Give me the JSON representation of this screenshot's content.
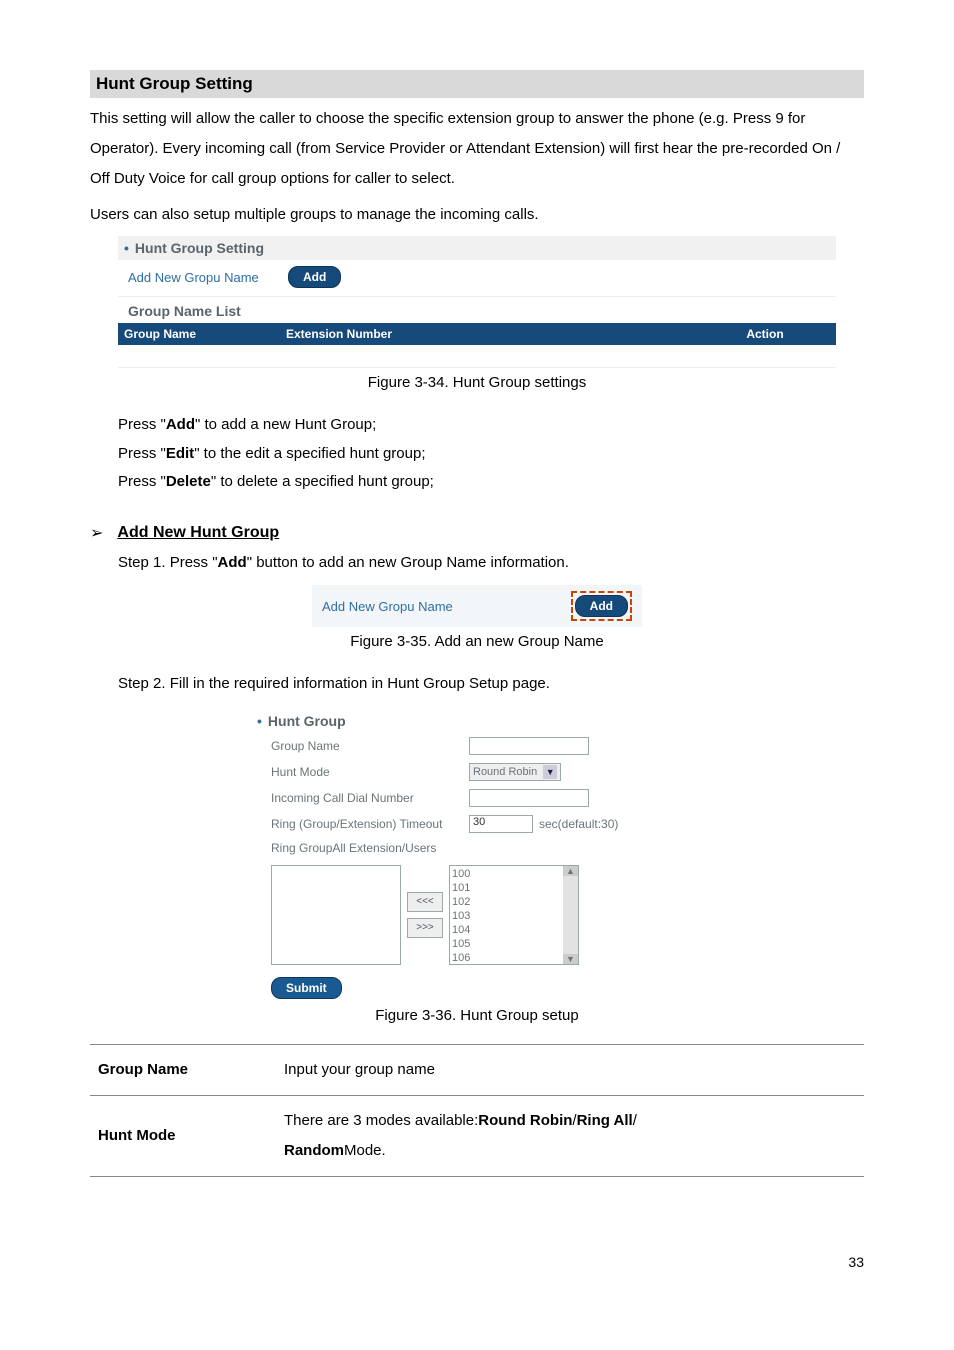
{
  "section": {
    "title": "Hunt Group Setting"
  },
  "intro": {
    "p1": "This setting will allow the caller to choose the specific extension group to answer the phone (e.g. Press 9 for Operator). Every incoming call (from Service Provider or Attendant Extension) will first hear the pre-recorded On / Off Duty Voice for call group options for caller to select.",
    "p2": "Users can also setup multiple groups to manage the incoming calls."
  },
  "fig34": {
    "bullet_title": "Hunt Group Setting",
    "add_label": "Add New Gropu Name",
    "add_btn": "Add",
    "list_title": "Group Name List",
    "th_group": "Group Name",
    "th_ext": "Extension Number",
    "th_action": "Action",
    "caption": "Figure 3-34. Hunt Group settings"
  },
  "press_lines": {
    "l1a": "Press \"",
    "l1b": "Add",
    "l1c": "\" to add a new Hunt Group;",
    "l2a": "Press \"",
    "l2b": "Edit",
    "l2c": "\" to the edit a specified hunt group;",
    "l3a": "Press \"",
    "l3b": "Delete",
    "l3c": "\" to delete a specified hunt group;"
  },
  "sub1": {
    "arrow": "➢",
    "title": "Add New Hunt Group",
    "step1a": "Step 1. Press \"",
    "step1b": "Add",
    "step1c": "\" button to add an new Group Name information."
  },
  "fig35": {
    "label": "Add New Gropu Name",
    "btn": "Add",
    "caption": "Figure 3-35. Add an new Group Name"
  },
  "step2": "Step 2. Fill in the required information in Hunt Group Setup page.",
  "fig36": {
    "hdr": "Hunt Group",
    "group_name_lbl": "Group Name",
    "hunt_mode_lbl": "Hunt Mode",
    "hunt_mode_val": "Round Robin",
    "dial_lbl": "Incoming Call Dial Number",
    "timeout_lbl": "Ring (Group/Extension) Timeout",
    "timeout_val": "30",
    "timeout_suffix": "sec(default:30)",
    "ring_group_lbl": "Ring Group",
    "all_ext_lbl": "All Extension/Users",
    "ext_list": [
      "100",
      "101",
      "102",
      "103",
      "104",
      "105",
      "106"
    ],
    "mv_left": "<<<",
    "mv_right": ">>>",
    "submit": "Submit",
    "caption": "Figure 3-36. Hunt Group setup"
  },
  "desc": {
    "row1_k": "Group Name",
    "row1_v": "Input your group name",
    "row2_k": "Hunt Mode",
    "row2_a": "There are 3 modes available: ",
    "row2_b": "Round Robin",
    "row2_c": " / ",
    "row2_d": "Ring All",
    "row2_e": " / ",
    "row2_f": "Random",
    "row2_g": " Mode."
  },
  "page_number": "33"
}
